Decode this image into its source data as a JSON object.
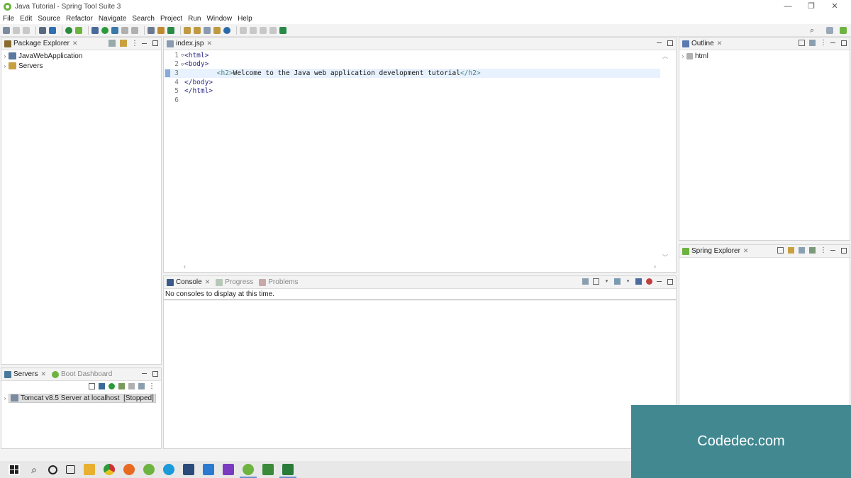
{
  "window": {
    "title": "Java Tutorial - Spring Tool Suite 3"
  },
  "menu": [
    "File",
    "Edit",
    "Source",
    "Refactor",
    "Navigate",
    "Search",
    "Project",
    "Run",
    "Window",
    "Help"
  ],
  "package_explorer": {
    "tab_label": "Package Explorer",
    "items": [
      {
        "label": "JavaWebApplication",
        "icon": "project-icon"
      },
      {
        "label": "Servers",
        "icon": "folder-icon"
      }
    ]
  },
  "editor": {
    "tab_label": "index.jsp",
    "lines": [
      {
        "num": "1",
        "fold": "⊖",
        "text": "<html>"
      },
      {
        "num": "2",
        "fold": "⊖",
        "text": "<body>"
      },
      {
        "num": "3",
        "fold": "",
        "tag_open": "<h2>",
        "text_content": "Welcome to the Java web application development tutorial",
        "tag_close": "</h2>"
      },
      {
        "num": "4",
        "fold": "",
        "text": "</body>"
      },
      {
        "num": "5",
        "fold": "",
        "text": "</html>"
      },
      {
        "num": "6",
        "fold": "",
        "text": ""
      }
    ]
  },
  "outline": {
    "tab_label": "Outline",
    "items": [
      {
        "label": "html"
      }
    ]
  },
  "spring_explorer": {
    "tab_label": "Spring Explorer"
  },
  "console": {
    "tabs": [
      "Console",
      "Progress",
      "Problems"
    ],
    "message": "No consoles to display at this time."
  },
  "servers": {
    "tabs": [
      "Servers",
      "Boot Dashboard"
    ],
    "items": [
      {
        "label": "Tomcat v8.5 Server at localhost  [Stopped]"
      }
    ]
  },
  "watermark": {
    "text": "Codedec.com"
  },
  "colors": {
    "spring_green": "#6db33f",
    "watermark_bg": "#418891"
  }
}
